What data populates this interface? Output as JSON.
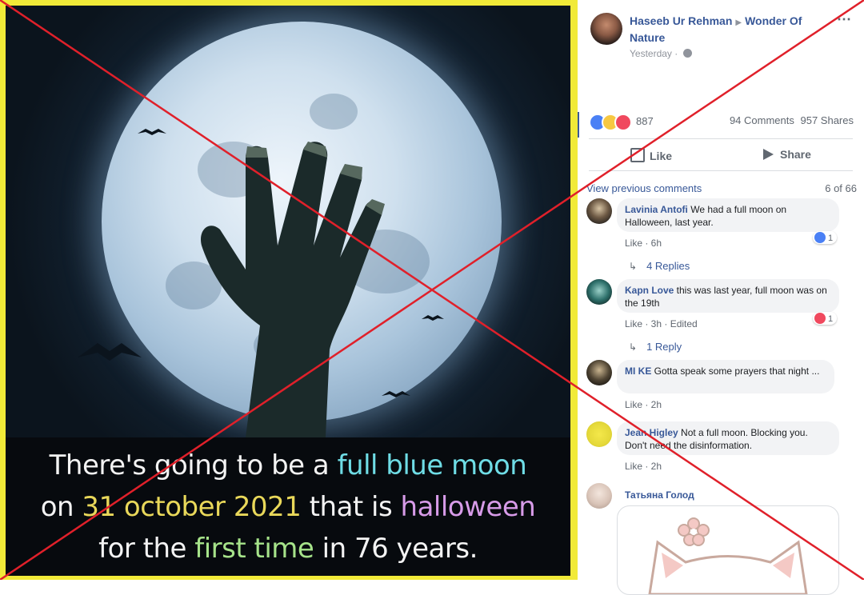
{
  "post": {
    "author": "Haseeb Ur Rehman",
    "group": "Wonder Of Nature",
    "timestamp": "Yesterday",
    "more_icon": "⋯",
    "reactions_count": "887",
    "comments_count": "94 Comments",
    "shares_count": "957 Shares",
    "like_label": "Like",
    "share_label": "Share"
  },
  "image": {
    "caption_line1_a": "There's going to be a ",
    "caption_line1_b": "full blue moon",
    "caption_line2_a": "on ",
    "caption_line2_b": "31 october 2021",
    "caption_line2_c": " that is ",
    "caption_line2_d": "halloween",
    "caption_line3_a": "for the ",
    "caption_line3_b": "first time",
    "caption_line3_c": " in 76 years."
  },
  "comments_header": {
    "view_previous": "View previous comments",
    "pager": "6 of 66"
  },
  "comments": [
    {
      "name": "Lavinia Antofi",
      "text": " We had a full moon on Halloween, last year.",
      "meta": "Like · 6h",
      "reaction_count": "1",
      "replies": "4 Replies"
    },
    {
      "name": "Kapn Love",
      "text": " this was last year, full moon was on the 19th",
      "meta": "Like · 3h · Edited",
      "reaction_count": "1",
      "replies": "1 Reply"
    },
    {
      "name": "MI KE",
      "text": " Gotta speak some prayers that night ...",
      "meta": "Like · 2h"
    },
    {
      "name": "Jean Higley",
      "text": " Not a full moon. Blocking you. Don't need the disinformation.",
      "meta": "Like · 2h"
    },
    {
      "name": "Татьяна Голод"
    }
  ],
  "colors": {
    "link": "#385898",
    "frame_yellow": "#f1ea38",
    "cross_red": "#e0202a",
    "caption_blue": "#6fdde6",
    "caption_yellow": "#e9d85a",
    "caption_pink": "#d79be8",
    "caption_green": "#a6e38a"
  },
  "icons": {
    "like": "thumbs-up-icon",
    "share": "share-arrow-icon",
    "privacy": "globe-icon",
    "reply": "reply-arrow-icon"
  }
}
